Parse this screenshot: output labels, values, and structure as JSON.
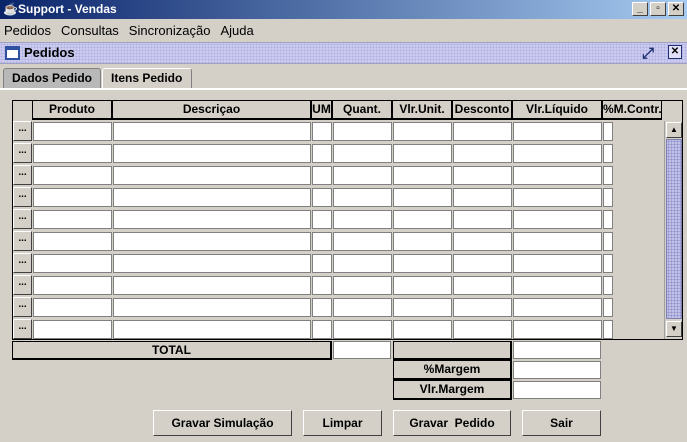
{
  "window": {
    "title": "Support - Vendas",
    "minimize": "_",
    "restore": "▫",
    "close": "✕"
  },
  "menu": [
    "Pedidos",
    "Consultas",
    "Sincronização",
    "Ajuda"
  ],
  "frame": {
    "title": "Pedidos"
  },
  "tabs": [
    "Dados Pedido",
    "Itens Pedido"
  ],
  "table": {
    "columns": [
      "Produto",
      "Descriçao",
      "UM",
      "Quant.",
      "Vlr.Unit.",
      "Desconto",
      "Vlr.Líquido",
      "%M.Contr."
    ],
    "row_button": "...",
    "row_count": 10
  },
  "totals": {
    "total_label": "TOTAL",
    "margem_label": "%Margem",
    "vlr_margem_label": "Vlr.Margem"
  },
  "buttons": [
    "Gravar Simulação",
    "Limpar",
    "Gravar  Pedido",
    "Sair"
  ]
}
